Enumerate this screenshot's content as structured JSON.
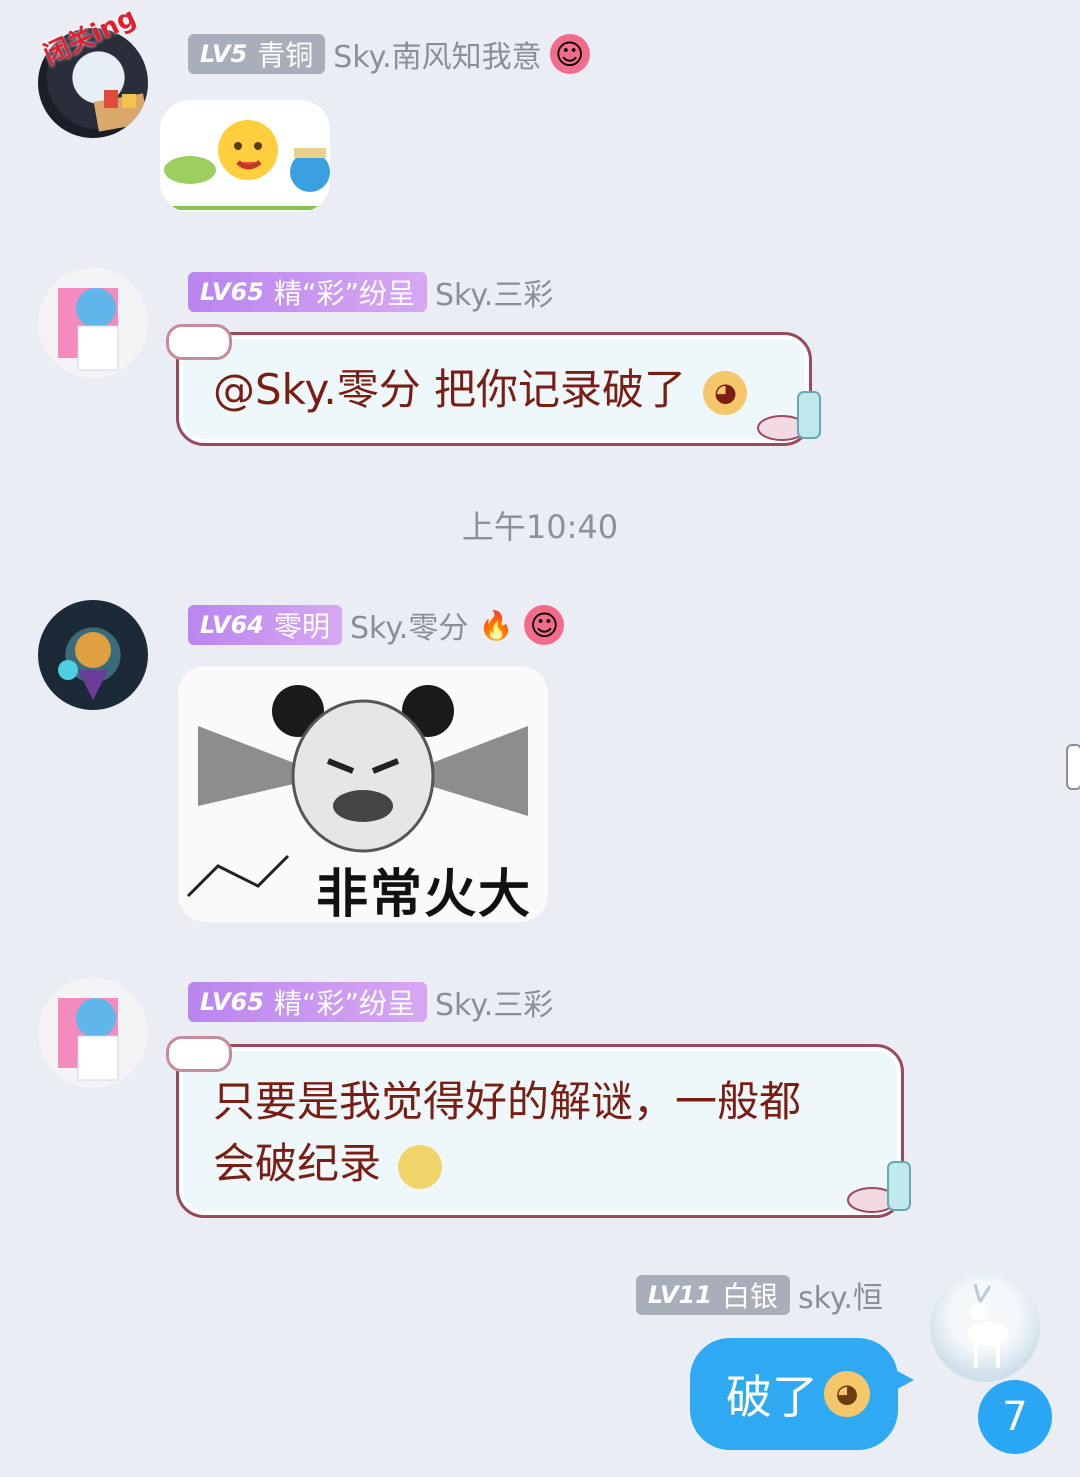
{
  "messages": [
    {
      "level": "LV5",
      "title": "青铜",
      "nickname": "Sky.南风知我意",
      "avatar_tag": "闭关ing"
    },
    {
      "level": "LV65",
      "title": "精“彩”纷呈",
      "nickname": "Sky.三彩",
      "text": "@Sky.零分 把你记录破了"
    },
    {
      "level": "LV64",
      "title": "零明",
      "nickname": "Sky.零分",
      "sticker_caption": "非常火大"
    },
    {
      "level": "LV65",
      "title": "精“彩”纷呈",
      "nickname": "Sky.三彩",
      "text_line1": "只要是我觉得好的解谜，一般都",
      "text_line2": "会破纪录"
    },
    {
      "level": "LV11",
      "title": "白银",
      "nickname": "sky.恒",
      "text": "破了"
    }
  ],
  "timestamp": "上午10:40",
  "unread_count": "7",
  "colors": {
    "background": "#eaedf4",
    "accent_blue": "#2fa9f2",
    "bubble_text": "#7a1e14"
  }
}
